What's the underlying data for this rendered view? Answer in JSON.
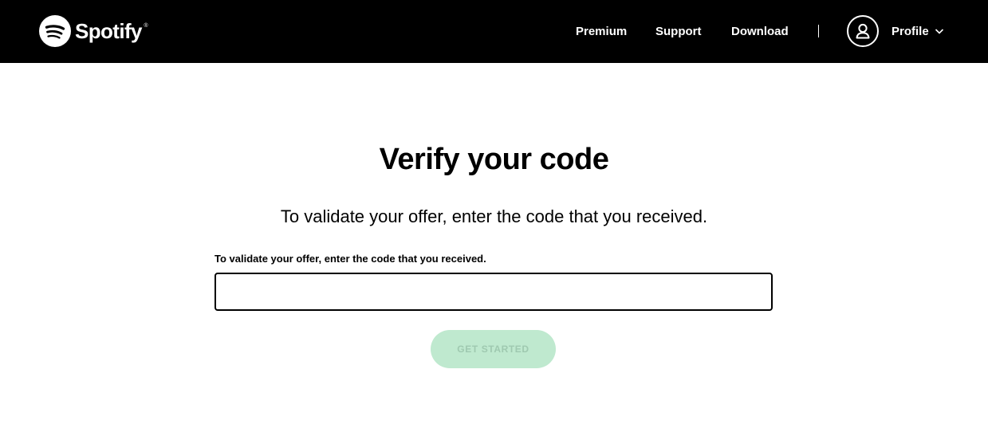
{
  "header": {
    "brand": "Spotify",
    "brand_mark": "®",
    "nav": {
      "premium": "Premium",
      "support": "Support",
      "download": "Download"
    },
    "profile_label": "Profile",
    "icons": {
      "logo": "spotify-logo-icon",
      "avatar": "user-icon",
      "chevron": "chevron-down-icon"
    }
  },
  "main": {
    "title": "Verify your code",
    "subtitle": "To validate your offer, enter the code that you received.",
    "field_label": "To validate your offer, enter the code that you received.",
    "code_value": "",
    "submit_label": "GET STARTED"
  },
  "colors": {
    "header_bg": "#000000",
    "button_disabled_bg": "#bfe9cf",
    "button_disabled_text": "#9fc9b0"
  }
}
